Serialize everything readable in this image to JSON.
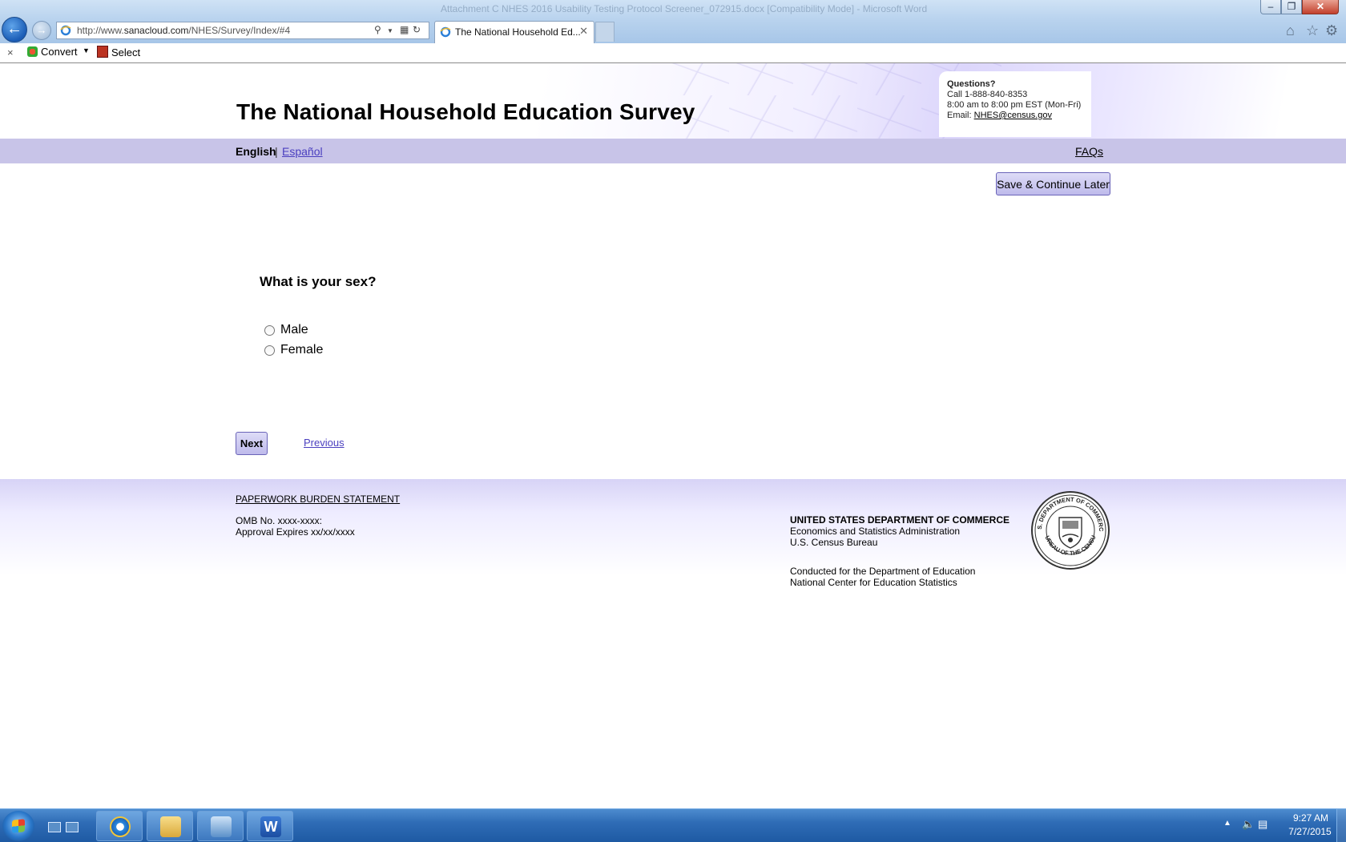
{
  "browser": {
    "window_title_ghost": "Attachment C NHES 2016 Usability Testing Protocol Screener_072915.docx [Compatibility Mode] - Microsoft Word",
    "address_prefix": "http://www.",
    "address_domain": "sanacloud.com",
    "address_path": "/NHES/Survey/Index/#4",
    "tab_title": "The National Household Ed...",
    "window_controls": {
      "minimize": "–",
      "maximize": "❐",
      "close": "✕"
    },
    "nav_icons": {
      "back": "back-arrow-icon",
      "forward": "forward-arrow-icon"
    },
    "right_icons": [
      "home-icon",
      "star-icon",
      "gear-icon"
    ]
  },
  "command_bar": {
    "close_glyph": "×",
    "convert_label": "Convert",
    "select_label": "Select"
  },
  "header": {
    "title": "The National Household Education Survey",
    "contact": {
      "questions_label": "Questions?",
      "phone_line": "Call 1-888-840-8353",
      "hours_line": "8:00 am to 8:00 pm EST (Mon-Fri)",
      "email_prefix": "Email: ",
      "email": "NHES@census.gov"
    }
  },
  "nav": {
    "english_label": "English",
    "separator": "|",
    "espanol_label": "Español",
    "faqs_label": "FAQs"
  },
  "survey": {
    "save_label": "Save & Continue Later",
    "question": "What is your sex?",
    "options": [
      {
        "label": "Male",
        "selected": false
      },
      {
        "label": "Female",
        "selected": false
      }
    ],
    "next_label": "Next",
    "previous_label": "Previous"
  },
  "footer": {
    "paperwork_label": "PAPERWORK BURDEN STATEMENT",
    "omb_line": "OMB No. xxxx-xxxx:",
    "approval_line": "Approval Expires xx/xx/xxxx",
    "dept_line": "UNITED STATES DEPARTMENT OF COMMERCE",
    "esa_line": "Economics and Statistics Administration",
    "census_line": "U.S. Census Bureau",
    "conducted_line": "Conducted for the Department of Education",
    "nces_line": "National Center for Education Statistics",
    "seal_top_text": "U.S. DEPARTMENT OF COMMERCE",
    "seal_bottom_text": "BUREAU OF THE CENSUS"
  },
  "taskbar": {
    "items": [
      "internet-explorer",
      "windows-explorer",
      "lync",
      "word"
    ],
    "word_glyph": "W",
    "clock_time": "9:27 AM",
    "clock_date": "7/27/2015"
  },
  "colors": {
    "nav_band": "#c8c4e8",
    "link": "#4a3fbf",
    "button_fill": "#c9c5f0",
    "button_border": "#6a64b8",
    "taskbar": "#2f6cb6"
  }
}
